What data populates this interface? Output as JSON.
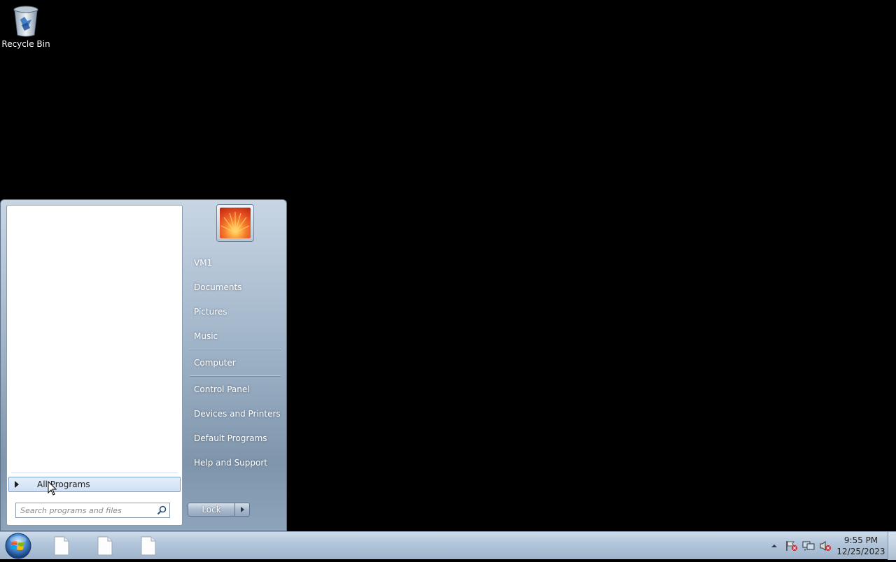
{
  "desktop": {
    "icons": [
      {
        "label": "Recycle Bin",
        "icon": "recycle-bin-icon"
      }
    ]
  },
  "start_menu": {
    "all_programs_label": "All Programs",
    "search_placeholder": "Search programs and files",
    "user_picture": "user-picture-flower",
    "right_items": [
      {
        "label": "VM1"
      },
      {
        "label": "Documents"
      },
      {
        "label": "Pictures"
      },
      {
        "label": "Music"
      },
      {
        "label": "Computer"
      },
      {
        "label": "Control Panel"
      },
      {
        "label": "Devices and Printers"
      },
      {
        "label": "Default Programs"
      },
      {
        "label": "Help and Support"
      }
    ],
    "lock_label": "Lock"
  },
  "taskbar": {
    "start_button": "windows-start-orb-icon",
    "items": [
      {
        "icon": "document-icon"
      },
      {
        "icon": "document-icon"
      },
      {
        "icon": "document-icon"
      }
    ],
    "tray": {
      "icons": [
        "show-hidden-icons-chevron",
        "action-center-flag-icon",
        "network-icon",
        "volume-muted-icon"
      ],
      "time": "9:55 PM",
      "date": "12/25/2023"
    }
  }
}
